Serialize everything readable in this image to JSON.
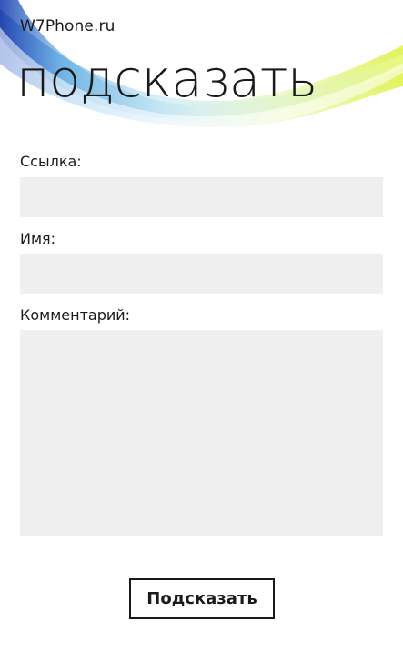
{
  "app": {
    "title": "W7Phone.ru"
  },
  "page": {
    "title": "подсказать"
  },
  "form": {
    "link_label": "Ссылка:",
    "link_value": "",
    "name_label": "Имя:",
    "name_value": "",
    "comment_label": "Комментарий:",
    "comment_value": "",
    "submit_label": "Подсказать"
  },
  "colors": {
    "text": "#1a1a1a",
    "input_bg": "#efefef",
    "background": "#ffffff"
  }
}
